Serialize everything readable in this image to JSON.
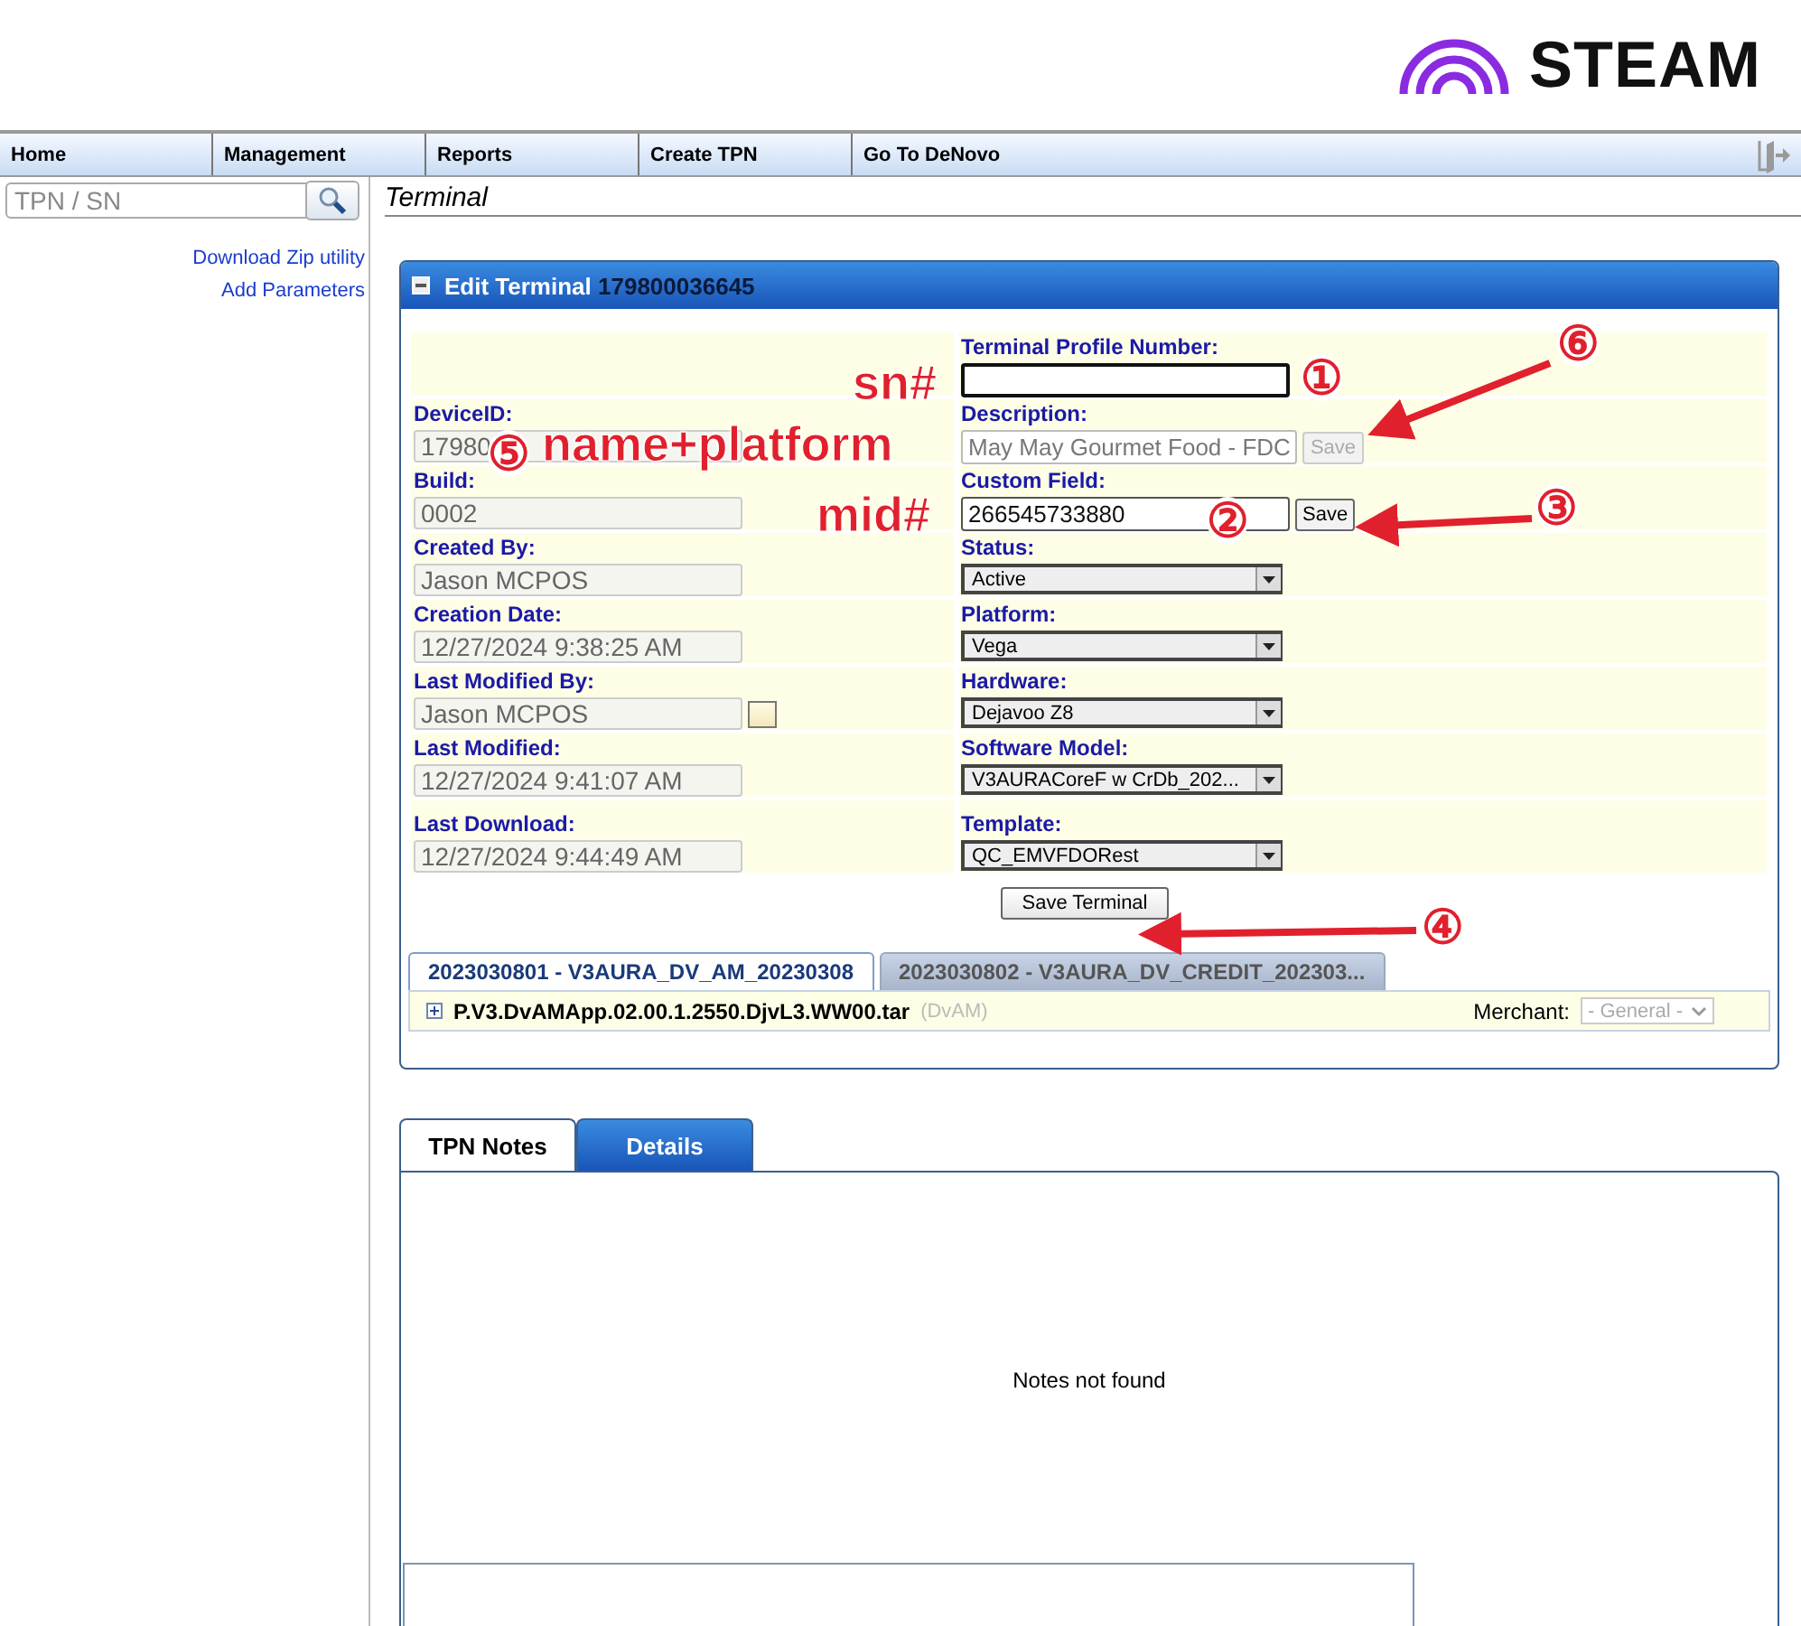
{
  "logo": {
    "text": "STEAM"
  },
  "nav": [
    {
      "label": "Home"
    },
    {
      "label": "Management"
    },
    {
      "label": "Reports"
    },
    {
      "label": "Create TPN"
    },
    {
      "label": "Go To DeNovo"
    }
  ],
  "search": {
    "placeholder": "TPN / SN"
  },
  "sidebar_links": [
    "Download Zip utility",
    "Add Parameters"
  ],
  "page_title": "Terminal",
  "panel": {
    "title": "Edit Terminal",
    "terminal_id": "179800036645",
    "rows": [
      {
        "right": {
          "label": "Terminal Profile Number:",
          "kind": "input"
        }
      },
      {
        "left": {
          "label": "DeviceID:",
          "value": "17980"
        },
        "right": {
          "label": "Description:",
          "kind": "input",
          "value": "May May Gourmet Food - FDC",
          "readonly": true,
          "button": {
            "label": "Save",
            "disabled": true
          }
        }
      },
      {
        "left": {
          "label": "Build:",
          "value": "0002"
        },
        "right": {
          "label": "Custom Field:",
          "kind": "input",
          "value": "266545733880",
          "readonly": false,
          "button": {
            "label": "Save",
            "disabled": false
          }
        }
      },
      {
        "left": {
          "label": "Created By:",
          "value": "Jason MCPOS"
        },
        "right": {
          "label": "Status:",
          "kind": "select",
          "value": "Active"
        }
      },
      {
        "left": {
          "label": "Creation Date:",
          "value": "12/27/2024 9:38:25 AM"
        },
        "right": {
          "label": "Platform:",
          "kind": "select",
          "value": "Vega"
        }
      },
      {
        "left": {
          "label": "Last Modified By:",
          "value": "Jason MCPOS",
          "calendar": true
        },
        "right": {
          "label": "Hardware:",
          "kind": "select",
          "value": "Dejavoo Z8"
        }
      },
      {
        "left": {
          "label": "Last Modified:",
          "value": "12/27/2024 9:41:07 AM"
        },
        "right": {
          "label": "Software Model:",
          "kind": "select",
          "value": "V3AURACoreF w CrDb_202..."
        }
      },
      {
        "left": {
          "label": "Last Download:",
          "value": "12/27/2024 9:44:49 AM"
        },
        "right": {
          "label": "Template:",
          "kind": "select",
          "value": "QC_EMVFDORest"
        }
      }
    ],
    "save_button": "Save Terminal",
    "package_tabs": [
      {
        "label": "2023030801 - V3AURA_DV_AM_20230308",
        "selected": true
      },
      {
        "label": "2023030802 - V3AURA_DV_CREDIT_202303...",
        "selected": false
      }
    ],
    "package": {
      "name": "P.V3.DvAMApp.02.00.1.2550.DjvL3.WW00.tar",
      "tag": "(DvAM)",
      "merchant_label": "Merchant:",
      "merchant_value": "- General -"
    }
  },
  "notes_tabs": [
    {
      "label": "TPN Notes",
      "selected": true
    },
    {
      "label": "Details",
      "selected": false
    }
  ],
  "notes_message": "Notes not found",
  "annotations": [
    {
      "kind": "number",
      "text": "①"
    },
    {
      "kind": "number",
      "text": "②"
    },
    {
      "kind": "number",
      "text": "③"
    },
    {
      "kind": "number",
      "text": "④"
    },
    {
      "kind": "number",
      "text": "⑤"
    },
    {
      "kind": "number",
      "text": "⑥"
    },
    {
      "kind": "note",
      "text": "sn#"
    },
    {
      "kind": "note",
      "text": "name+platform"
    },
    {
      "kind": "note",
      "text": "mid#"
    }
  ]
}
